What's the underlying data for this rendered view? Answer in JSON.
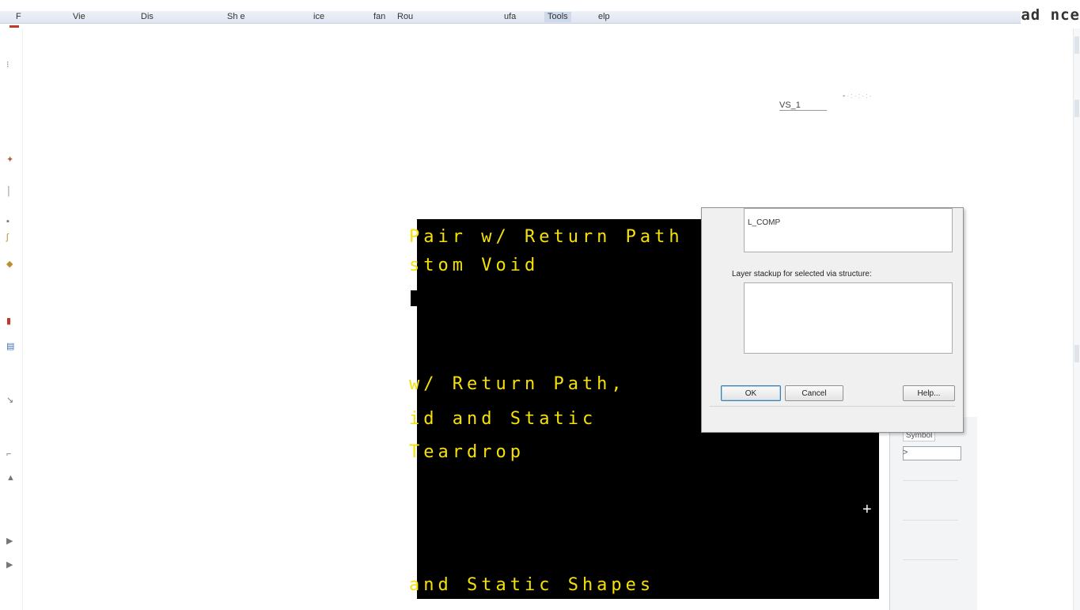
{
  "menu": {
    "items": [
      "F",
      "Vie",
      "Dis",
      "Sh e",
      "ice",
      "fan",
      "Rou",
      "ufa",
      "Tools",
      "elp"
    ],
    "right_text": "ad nce"
  },
  "canvas": {
    "lines": [
      "Pair w/ Return Path",
      "stom Void",
      "w/ Return Path,",
      "id and Static",
      "Teardrop",
      "and Static Shapes"
    ],
    "via_label": "VS_1",
    "crosshair": "+"
  },
  "dialog": {
    "list1_text": "L_COMP",
    "stackup_label": "Layer stackup for selected via structure:",
    "ok_label": "OK",
    "cancel_label": "Cancel",
    "help_label": "Help..."
  },
  "side_panel": {
    "symbol_label": "Symbol",
    "arrow": ">"
  },
  "colors": {
    "canvas_bg": "#000000",
    "canvas_text": "#f5e00a",
    "dialog_bg": "#f0f0f0"
  }
}
